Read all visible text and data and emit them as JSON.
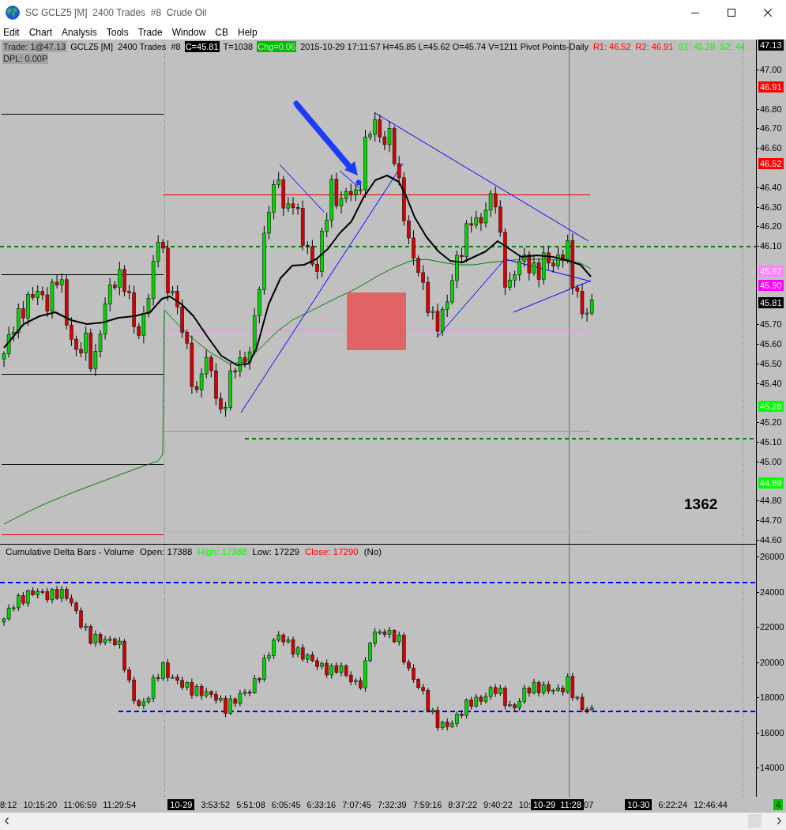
{
  "window": {
    "title": "SC GCLZ5 [M]  2400 Trades  #8  Crude Oil"
  },
  "menu": [
    "Edit",
    "Chart",
    "Analysis",
    "Tools",
    "Trade",
    "Window",
    "CB",
    "Help"
  ],
  "price_pane": {
    "header": [
      {
        "text": "Trade: 1@47.13",
        "kind": "shaded"
      },
      {
        "text": "GCLZ5 [M]  2400 Trades  #8",
        "kind": "plain"
      },
      {
        "text": "C=45.81",
        "kind": "inverse"
      },
      {
        "text": "T=1038",
        "kind": "plain"
      },
      {
        "text": "Chg=0.06",
        "kind": "change"
      },
      {
        "text": "2015-10-29 17:11:57 H=45.85 L=45.62 O=45.74 V=1211 Pivot Points-Daily",
        "kind": "plain"
      },
      {
        "text": "R1: 46.52",
        "kind": "negative"
      },
      {
        "text": "R2: 46.91",
        "kind": "negative"
      },
      {
        "text": "S1: 45.28",
        "kind": "positive"
      },
      {
        "text": "S2: 44.",
        "kind": "positive"
      }
    ],
    "subheader": [
      {
        "text": "DPL: 0.00P",
        "kind": "shaded"
      }
    ],
    "bar_count": "1362",
    "axis": {
      "ticks": [
        "47.00",
        "46.80",
        "46.70",
        "46.60",
        "46.40",
        "46.30",
        "46.20",
        "46.10",
        "45.70",
        "45.60",
        "45.50",
        "45.40",
        "45.20",
        "45.10",
        "45.00",
        "44.80",
        "44.70",
        "44.60"
      ],
      "markers": [
        {
          "label": "47.13",
          "color": "#000000"
        },
        {
          "label": "46.91",
          "color": "#ff0000"
        },
        {
          "label": "46.52",
          "color": "#ff0000"
        },
        {
          "label": "45.97",
          "color": "#ff80ff"
        },
        {
          "label": "45.90",
          "color": "#ff00ff"
        },
        {
          "label": "45.81",
          "color": "#000000"
        },
        {
          "label": "45.28",
          "color": "#00ff00"
        },
        {
          "label": "44.89",
          "color": "#00ff00"
        }
      ]
    }
  },
  "lower_pane": {
    "header": [
      {
        "text": "Cumulative Delta Bars - Volume",
        "kind": "plain"
      },
      {
        "text": "Open: 17388",
        "kind": "plain"
      },
      {
        "text": "High: 17388",
        "kind": "positive"
      },
      {
        "text": "Low: 17229",
        "kind": "plain"
      },
      {
        "text": "Close: 17290",
        "kind": "negative"
      },
      {
        "text": "(No)",
        "kind": "plain"
      }
    ],
    "axis": {
      "ticks": [
        "26000",
        "24000",
        "22000",
        "20000",
        "18000",
        "16000",
        "14000"
      ]
    }
  },
  "time_axis": {
    "labels": [
      {
        "text": "8:12",
        "kind": "time"
      },
      {
        "text": "10:15:20",
        "kind": "time"
      },
      {
        "text": "11:06:59",
        "kind": "time"
      },
      {
        "text": "11:29:54",
        "kind": "time"
      },
      {
        "text": "10-29",
        "kind": "date"
      },
      {
        "text": "3:53:52",
        "kind": "time"
      },
      {
        "text": "5:51:08",
        "kind": "time"
      },
      {
        "text": "6:05:45",
        "kind": "time"
      },
      {
        "text": "6:33:16",
        "kind": "time"
      },
      {
        "text": "7:07:45",
        "kind": "time"
      },
      {
        "text": "7:32:39",
        "kind": "time"
      },
      {
        "text": "7:59:16",
        "kind": "time"
      },
      {
        "text": "8:37:22",
        "kind": "time"
      },
      {
        "text": "9:40:22",
        "kind": "time"
      },
      {
        "text": "10:",
        "kind": "time"
      },
      {
        "text": "10-29  11:28",
        "kind": "cursor"
      },
      {
        "text": "07",
        "kind": "time"
      },
      {
        "text": "10-30",
        "kind": "date"
      },
      {
        "text": "6:22:24",
        "kind": "time"
      },
      {
        "text": "12:46:44",
        "kind": "time"
      }
    ],
    "corner": "4"
  }
}
